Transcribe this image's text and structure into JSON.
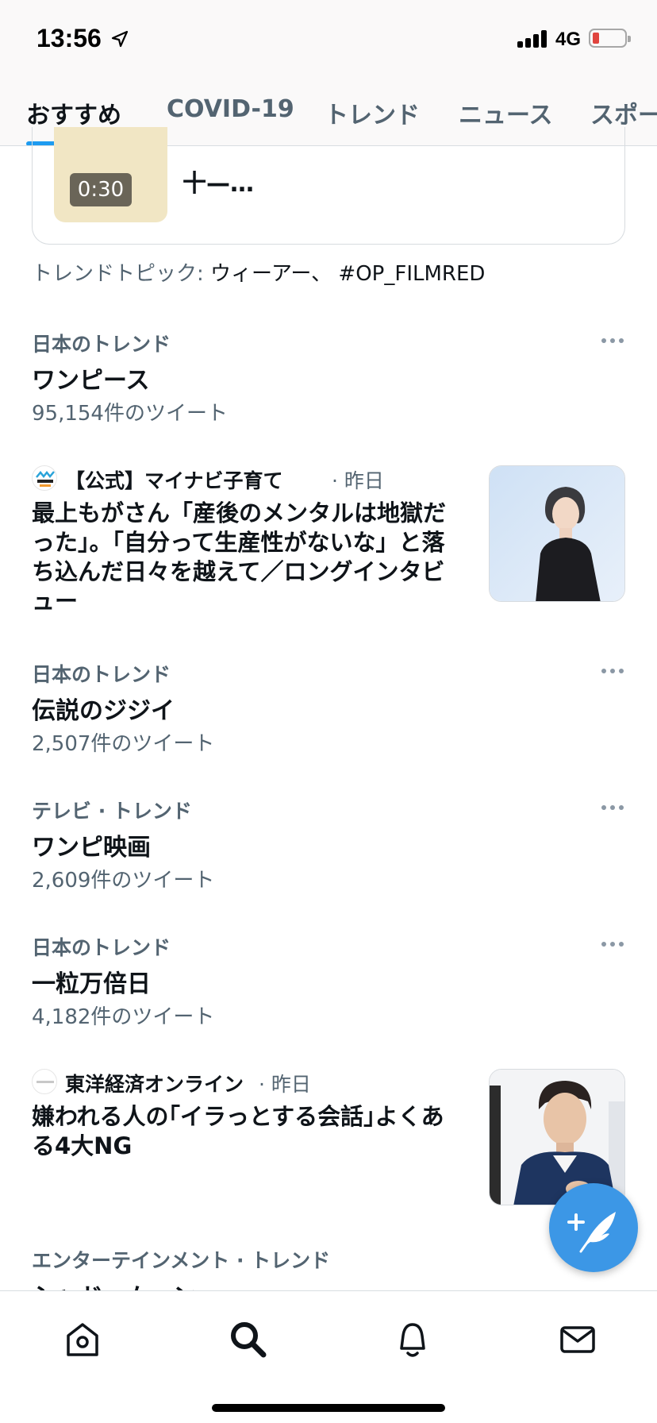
{
  "status_bar": {
    "time": "13:56",
    "network": "4G"
  },
  "tabs": [
    {
      "label": "おすすめ",
      "active": true
    },
    {
      "label": "COVID-19",
      "active": false
    },
    {
      "label": "トレンド",
      "active": false
    },
    {
      "label": "ニュース",
      "active": false
    },
    {
      "label": "スポー",
      "active": false
    }
  ],
  "top_card": {
    "duration": "0:30",
    "text": "十—…",
    "trend_topics_label": "トレンドトピック:",
    "trend_topics_value": "ウィーアー、 #OP_FILMRED"
  },
  "trends": [
    {
      "category": "日本のトレンド",
      "name": "ワンピース",
      "count": "95,154件のツイート"
    },
    {
      "category": "日本のトレンド",
      "name": "伝説のジジイ",
      "count": "2,507件のツイート"
    },
    {
      "category": "テレビ · トレンド",
      "name": "ワンピ映画",
      "count": "2,609件のツイート"
    },
    {
      "category": "日本のトレンド",
      "name": "一粒万倍日",
      "count": "4,182件のツイート"
    }
  ],
  "news": [
    {
      "source": "【公式】マイナビ子育て",
      "time": "· 昨日",
      "headline": "最上もがさん「産後のメンタルは地獄だった」。「自分って生産性がないな」と落ち込んだ日々を越えて／ロングインタビュー"
    },
    {
      "source": "東洋経済オンライン",
      "time": "· 昨日",
      "headline": "嫌われる人の｢イラっとする会話｣よくある4大NG"
    }
  ],
  "last_trend": {
    "category": "エンターテインメント · トレンド",
    "name": "シャドームーン"
  },
  "colors": {
    "accent": "#1d9bf0",
    "fab": "#3c97e6",
    "secondary_text": "#536471"
  },
  "nav": [
    "home-icon",
    "search-icon",
    "notifications-icon",
    "messages-icon"
  ]
}
